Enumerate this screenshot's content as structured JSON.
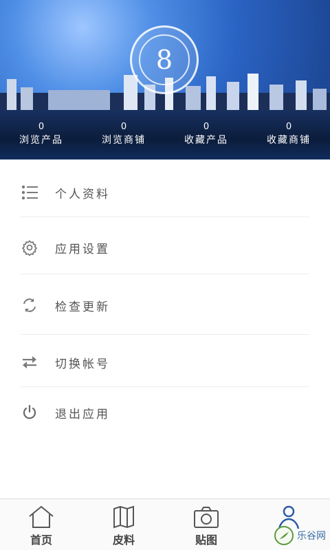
{
  "header": {
    "stats": [
      {
        "count": "0",
        "label": "浏览产品"
      },
      {
        "count": "0",
        "label": "浏览商铺"
      },
      {
        "count": "0",
        "label": "收藏产品"
      },
      {
        "count": "0",
        "label": "收藏商铺"
      }
    ],
    "avatar_glyph": "8"
  },
  "menu": [
    {
      "label": "个人资料",
      "icon": "list-icon"
    },
    {
      "label": "应用设置",
      "icon": "gear-icon"
    },
    {
      "label": "检查更新",
      "icon": "refresh-icon"
    },
    {
      "label": "切换帐号",
      "icon": "swap-icon"
    },
    {
      "label": "退出应用",
      "icon": "power-icon"
    }
  ],
  "tabs": [
    {
      "label": "首页",
      "icon": "home-icon"
    },
    {
      "label": "皮料",
      "icon": "map-icon"
    },
    {
      "label": "贴图",
      "icon": "camera-icon"
    },
    {
      "label": "",
      "icon": "person-icon",
      "active": true
    }
  ],
  "watermark": {
    "text": "乐谷网"
  }
}
